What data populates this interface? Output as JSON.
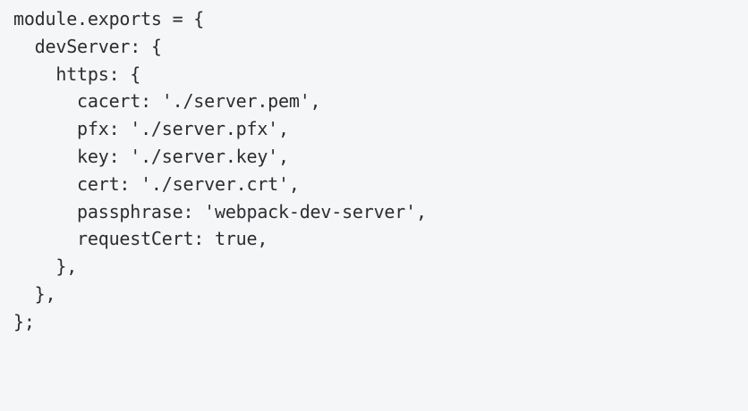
{
  "code": {
    "language": "javascript",
    "lines": [
      "module.exports = {",
      "  devServer: {",
      "    https: {",
      "      cacert: './server.pem',",
      "      pfx: './server.pfx',",
      "      key: './server.key',",
      "      cert: './server.crt',",
      "      passphrase: 'webpack-dev-server',",
      "      requestCert: true,",
      "    },",
      "  },",
      "};"
    ]
  },
  "colors": {
    "background": "#f5f6f7",
    "text": "#2b2d31"
  }
}
